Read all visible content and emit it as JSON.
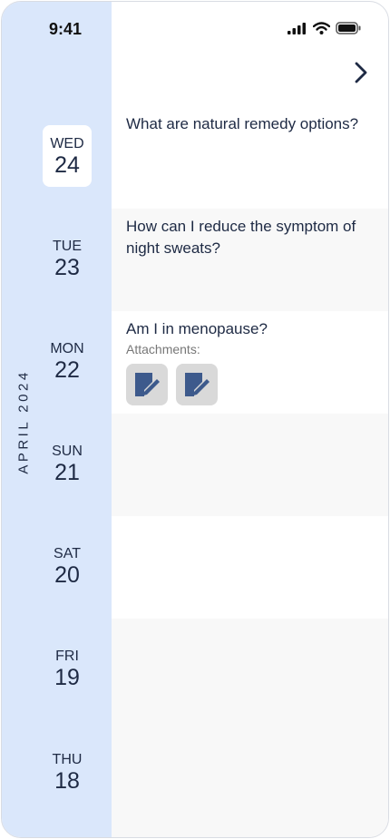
{
  "status": {
    "time": "9:41"
  },
  "calendar": {
    "month_label": "APRIL 2024",
    "days": [
      {
        "dow": "WED",
        "num": "24"
      },
      {
        "dow": "TUE",
        "num": "23"
      },
      {
        "dow": "MON",
        "num": "22"
      },
      {
        "dow": "SUN",
        "num": "21"
      },
      {
        "dow": "SAT",
        "num": "20"
      },
      {
        "dow": "FRI",
        "num": "19"
      },
      {
        "dow": "THU",
        "num": "18"
      }
    ]
  },
  "entries": {
    "q24": "What are natural remedy options?",
    "q23": "How can I reduce the symptom of night sweats?",
    "q22": "Am I in menopause?",
    "attachments_label": "Attachments:"
  },
  "colors": {
    "sidebar": "#dae7fb",
    "accent": "#3d5a8c",
    "attachment_bg": "#d9d9d9",
    "alt_row": "#f8f8f8"
  },
  "icons": {
    "next": "chevron-right-icon",
    "attachment": "document-edit-icon"
  }
}
